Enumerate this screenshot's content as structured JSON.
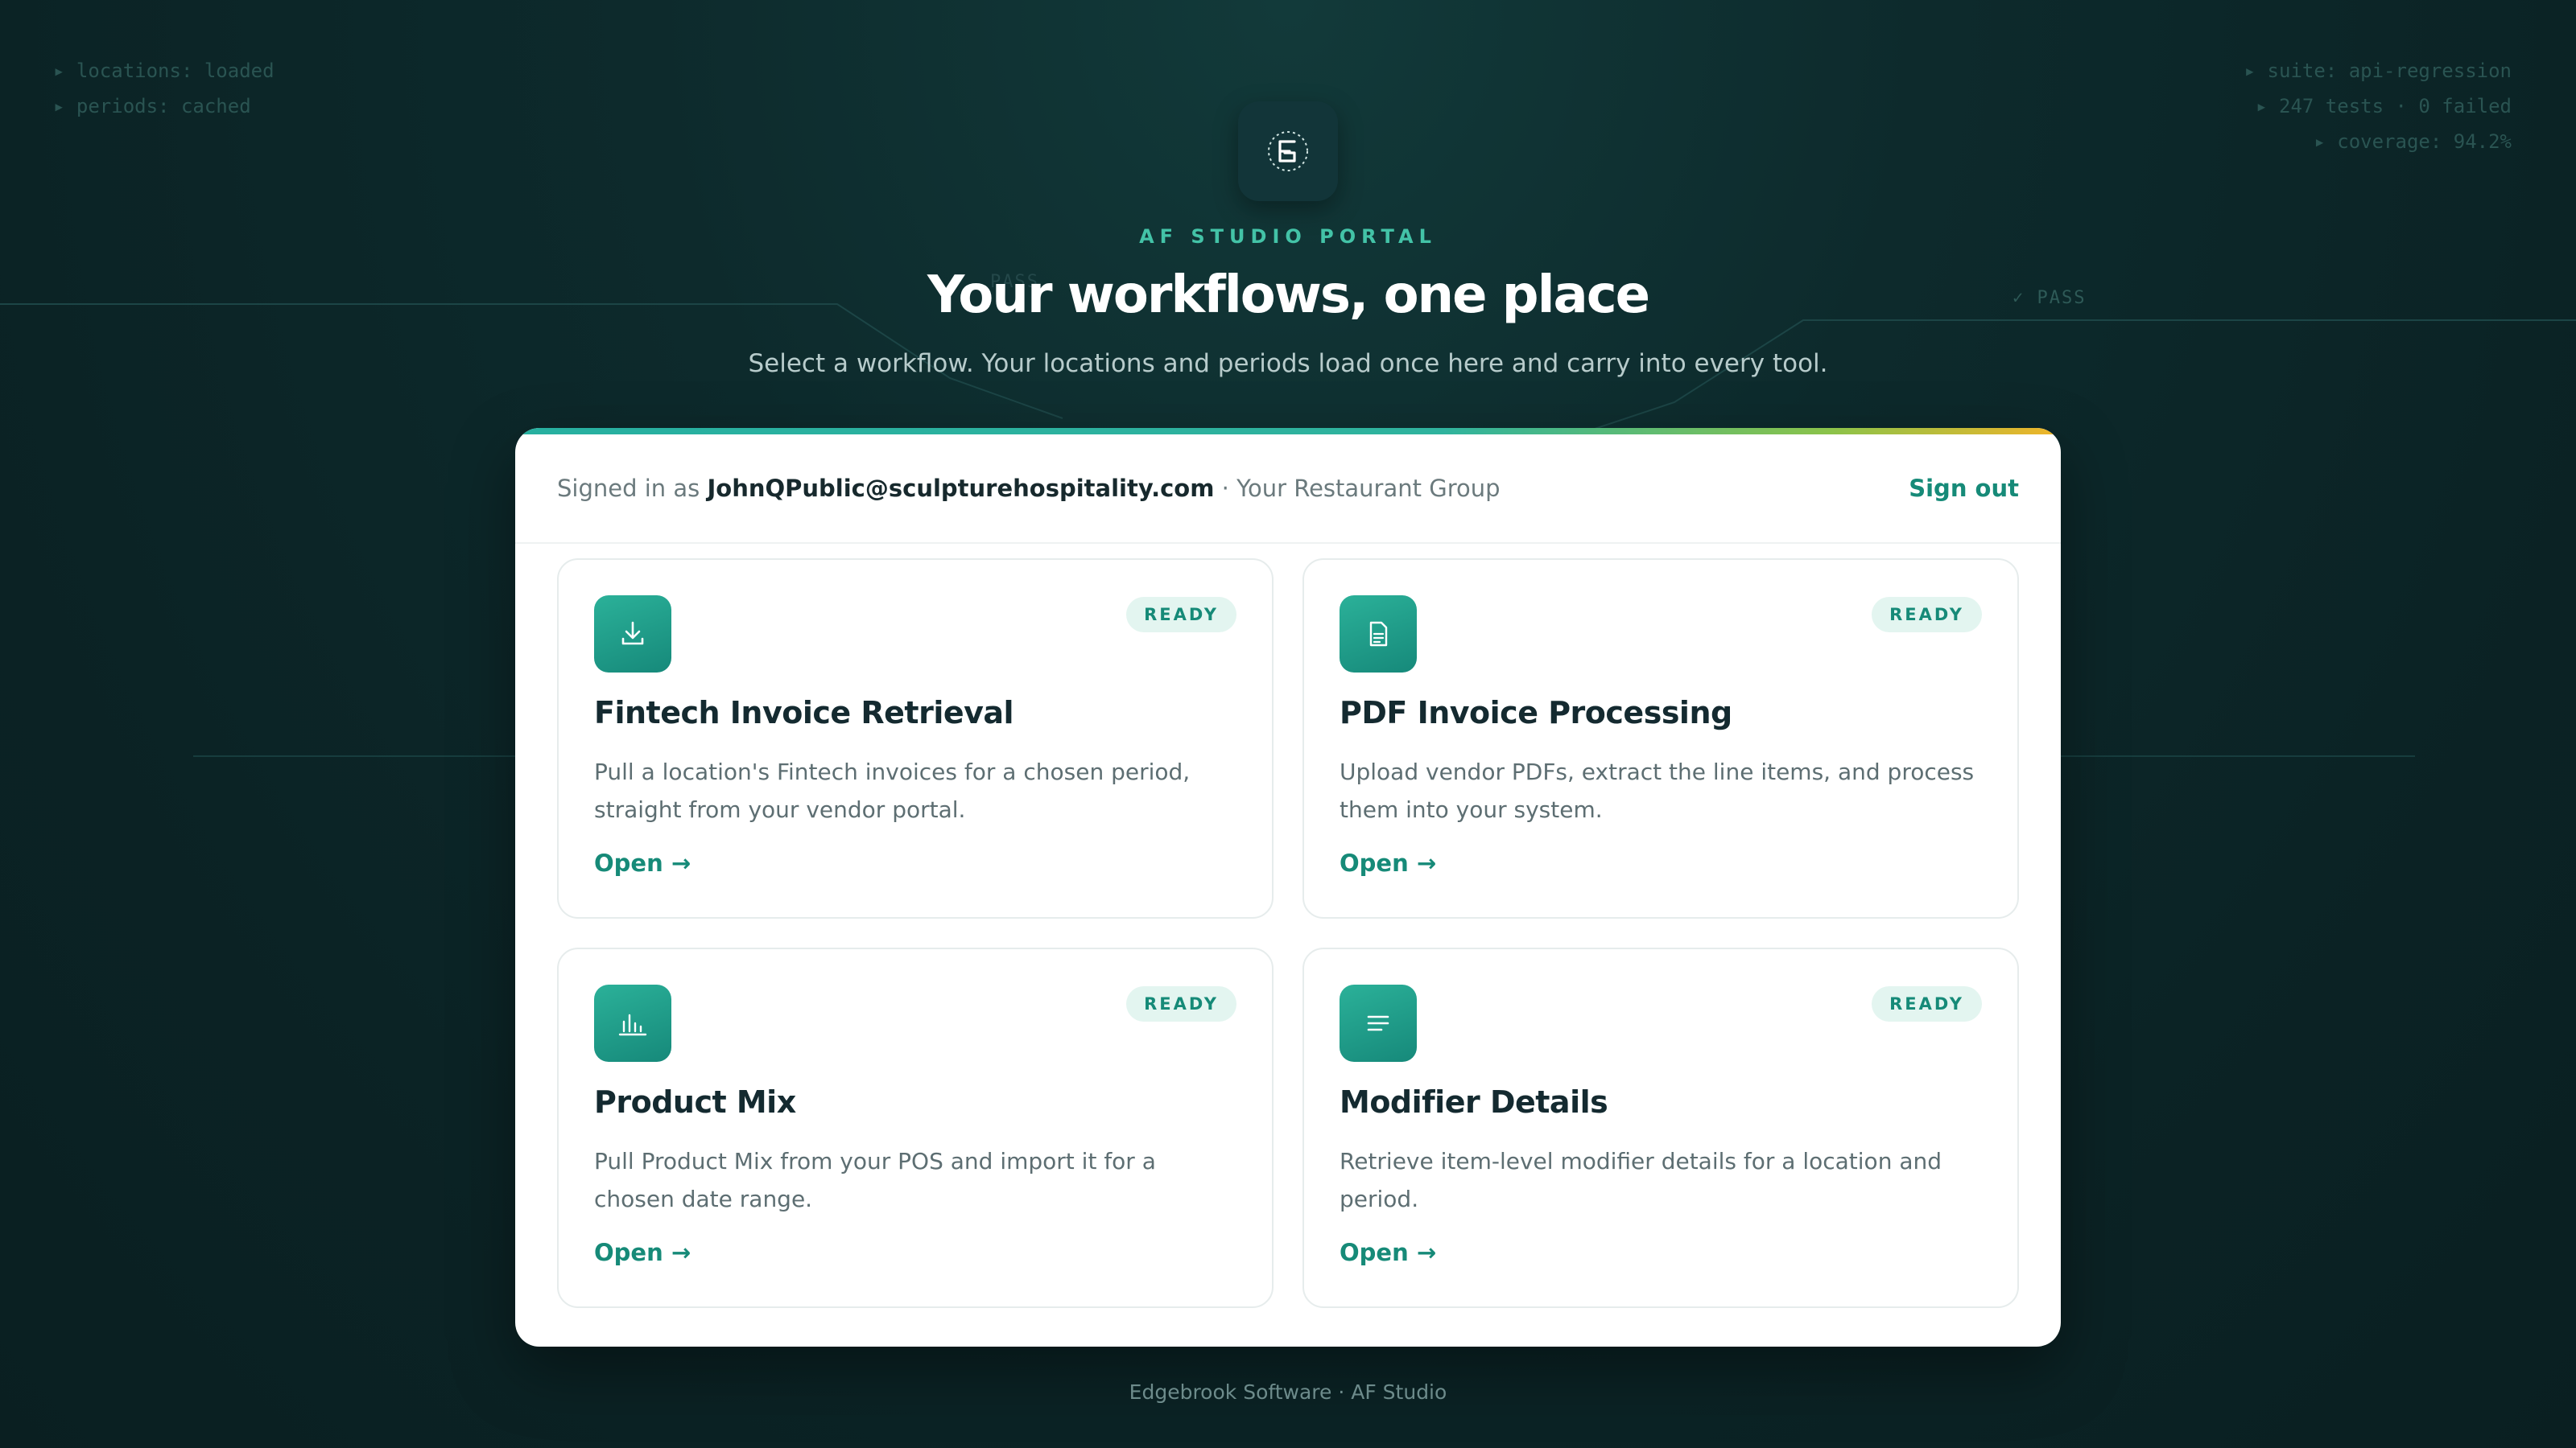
{
  "background": {
    "left_terminal": [
      "▸ locations: loaded",
      "▸ periods: cached"
    ],
    "right_terminal": [
      "▸ suite: api-regression",
      "▸ 247 tests · 0 failed",
      "▸ coverage: 94.2%"
    ],
    "pass_labels": [
      "PASS",
      "✓ PASS"
    ]
  },
  "header": {
    "logo_icon": "af-studio-logo-icon",
    "eyebrow": "AF STUDIO PORTAL",
    "title": "Your workflows, one place",
    "subtitle": "Select a workflow. Your locations and periods load once here and carry into every tool."
  },
  "session": {
    "prefix": "Signed in as",
    "email": "JohnQPublic@sculpturehospitality.com",
    "org": "· Your Restaurant Group",
    "sign_out_label": "Sign out"
  },
  "workflows": [
    {
      "icon": "download-icon",
      "title": "Fintech Invoice Retrieval",
      "description": "Pull a location's Fintech invoices for a chosen period, straight from your vendor portal.",
      "status": "READY",
      "open_label": "Open →"
    },
    {
      "icon": "document-icon",
      "title": "PDF Invoice Processing",
      "description": "Upload vendor PDFs, extract the line items, and process them into your system.",
      "status": "READY",
      "open_label": "Open →"
    },
    {
      "icon": "bar-chart-icon",
      "title": "Product Mix",
      "description": "Pull Product Mix from your POS and import it for a chosen date range.",
      "status": "READY",
      "open_label": "Open →"
    },
    {
      "icon": "list-icon",
      "title": "Modifier Details",
      "description": "Retrieve item-level modifier details for a location and period.",
      "status": "READY",
      "open_label": "Open →"
    }
  ],
  "footer": "Edgebrook Software · AF Studio",
  "colors": {
    "accent": "#168a78",
    "badge_bg": "#e3f5f0",
    "eyebrow": "#43c3a7",
    "page_bg": "#0d2a2c"
  }
}
